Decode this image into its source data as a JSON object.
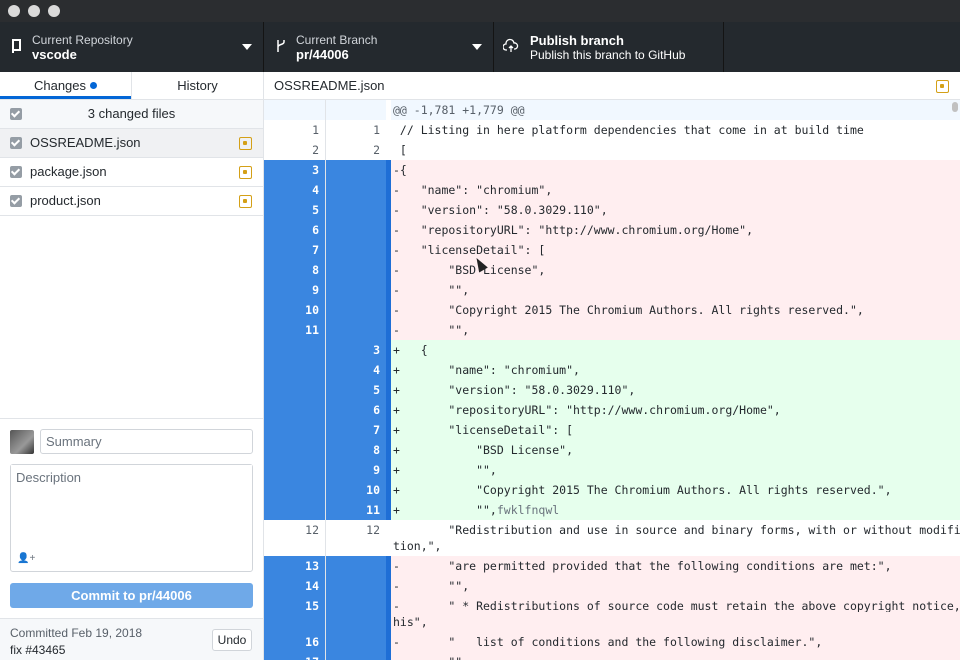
{
  "toolbar": {
    "repo_label": "Current Repository",
    "repo_value": "vscode",
    "branch_label": "Current Branch",
    "branch_value": "pr/44006",
    "publish_title": "Publish branch",
    "publish_subtitle": "Publish this branch to GitHub"
  },
  "sidebar": {
    "tabs": [
      {
        "label": "Changes"
      },
      {
        "label": "History"
      }
    ],
    "changed_count": "3 changed files",
    "files": [
      {
        "name": "OSSREADME.json"
      },
      {
        "name": "package.json"
      },
      {
        "name": "product.json"
      }
    ]
  },
  "commit": {
    "summary_placeholder": "Summary",
    "description_placeholder": "Description",
    "button_label": "Commit to pr/44006",
    "last_committed": "Committed Feb 19, 2018",
    "last_message": "fix #43465",
    "undo_label": "Undo"
  },
  "diff": {
    "filename": "OSSREADME.json",
    "hunk": "@@ -1,781 +1,779 @@",
    "lines": [
      {
        "old": "1",
        "new": "1",
        "text": " // Listing in here platform dependencies that come in at build time"
      },
      {
        "old": "2",
        "new": "2",
        "text": " ["
      },
      {
        "old": "3",
        "new": "",
        "text": "-{"
      },
      {
        "old": "4",
        "new": "",
        "text": "-   \"name\": \"chromium\","
      },
      {
        "old": "5",
        "new": "",
        "text": "-   \"version\": \"58.0.3029.110\","
      },
      {
        "old": "6",
        "new": "",
        "text": "-   \"repositoryURL\": \"http://www.chromium.org/Home\","
      },
      {
        "old": "7",
        "new": "",
        "text": "-   \"licenseDetail\": ["
      },
      {
        "old": "8",
        "new": "",
        "text": "-       \"BSD License\","
      },
      {
        "old": "9",
        "new": "",
        "text": "-       \"\","
      },
      {
        "old": "10",
        "new": "",
        "text": "-       \"Copyright 2015 The Chromium Authors. All rights reserved.\","
      },
      {
        "old": "11",
        "new": "",
        "text": "-       \"\","
      },
      {
        "old": "",
        "new": "3",
        "text": "+   {"
      },
      {
        "old": "",
        "new": "4",
        "text": "+       \"name\": \"chromium\","
      },
      {
        "old": "",
        "new": "5",
        "text": "+       \"version\": \"58.0.3029.110\","
      },
      {
        "old": "",
        "new": "6",
        "text": "+       \"repositoryURL\": \"http://www.chromium.org/Home\","
      },
      {
        "old": "",
        "new": "7",
        "text": "+       \"licenseDetail\": ["
      },
      {
        "old": "",
        "new": "8",
        "text": "+           \"BSD License\","
      },
      {
        "old": "",
        "new": "9",
        "text": "+           \"\","
      },
      {
        "old": "",
        "new": "10",
        "text": "+           \"Copyright 2015 The Chromium Authors. All rights reserved.\","
      },
      {
        "old": "",
        "new": "11",
        "text": "+           \"\",",
        "extra": "fwklfnqwl"
      },
      {
        "old": "12",
        "new": "12",
        "text": "        \"Redistribution and use in source and binary forms, with or without modifica"
      },
      {
        "old": "",
        "new": "",
        "text": "tion,\","
      },
      {
        "old": "13",
        "new": "",
        "text": "-       \"are permitted provided that the following conditions are met:\","
      },
      {
        "old": "14",
        "new": "",
        "text": "-       \"\","
      },
      {
        "old": "15",
        "new": "",
        "text": "-       \" * Redistributions of source code must retain the above copyright notice, t"
      },
      {
        "old": "",
        "new": "",
        "text": "his\","
      },
      {
        "old": "16",
        "new": "",
        "text": "-       \"   list of conditions and the following disclaimer.\","
      },
      {
        "old": "17",
        "new": "",
        "text": "-       \"\","
      }
    ]
  }
}
